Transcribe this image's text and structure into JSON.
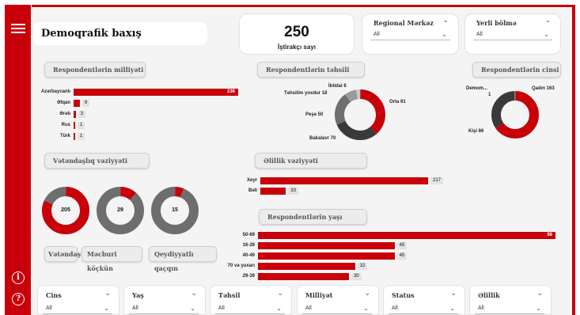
{
  "sidebar": {
    "menu_icon": "hamburger-menu-icon",
    "info_icon": "info-icon",
    "help_icon": "help-icon",
    "info_glyph": "i",
    "help_glyph": "?"
  },
  "header": {
    "title": "Demoqrafik baxış"
  },
  "participant_card": {
    "count": "250",
    "label": "İştirakçı sayı"
  },
  "top_slicers": [
    {
      "title": "Regional Mərkəz",
      "value": "All"
    },
    {
      "title": "Yerli bölmə",
      "value": "All"
    }
  ],
  "sections": {
    "nationality": "Respondentlərin milliyəti",
    "education": "Respondentlərin təhsili",
    "gender": "Respondentlərin cinsi",
    "citizenship": "Vətəndaşlıq vəziyyəti",
    "disability": "Əlillik vəziyyəti",
    "age": "Respondentlərin yaşı"
  },
  "nationality_chart": {
    "type": "bar",
    "categories": [
      "Azərbaycanlı",
      "Əfqan",
      "Ərəb",
      "Rus",
      "Türk"
    ],
    "values": [
      236,
      9,
      3,
      1,
      1
    ],
    "max": 236
  },
  "education_chart": {
    "type": "pie",
    "slices": [
      {
        "label": "Orta",
        "value": 91,
        "color": "#c8000a"
      },
      {
        "label": "Bakalavr",
        "value": 70,
        "color": "#3a3a3a"
      },
      {
        "label": "Peşə",
        "value": 50,
        "color": "#6e6e6e"
      },
      {
        "label": "Təhsilim yoxdur",
        "value": 18,
        "color": "#9a9a9a"
      },
      {
        "label": "İbtidai",
        "value": 6,
        "color": "#c8c8c8"
      }
    ]
  },
  "education_labels": [
    "Orta 91",
    "Bakalavr 70",
    "Peşə 50",
    "Təhsilim yoxdur 18",
    "İbtidai 6"
  ],
  "gender_chart": {
    "type": "pie",
    "slices": [
      {
        "label": "Qadın",
        "value": 163,
        "color": "#c8000a"
      },
      {
        "label": "Kişi",
        "value": 86,
        "color": "#3a3a3a"
      },
      {
        "label": "Demom...",
        "value": 1,
        "color": "#c8c8c8"
      }
    ]
  },
  "gender_labels": [
    "Qadın 163",
    "Kişi 86",
    "Demom...",
    "1"
  ],
  "citizenship_donuts": [
    {
      "center": "205",
      "value": 205,
      "total": 250,
      "label": "Vətəndaş"
    },
    {
      "center": "29",
      "value": 29,
      "total": 250,
      "label": "Məcburi köçkün"
    },
    {
      "center": "15",
      "value": 15,
      "total": 250,
      "label": "Qeydiyyatlı qaçqın"
    }
  ],
  "disability_chart": {
    "type": "bar",
    "categories": [
      "Xeyr",
      "Bəli"
    ],
    "values": [
      217,
      33
    ],
    "max": 217
  },
  "age_chart": {
    "type": "bar",
    "categories": [
      "50-69",
      "16-28",
      "40-49",
      "70 və yuxarı",
      "29-39"
    ],
    "values": [
      98,
      45,
      45,
      32,
      30
    ],
    "max": 98
  },
  "bottom_slicers": [
    {
      "title": "Cins",
      "value": "All"
    },
    {
      "title": "Yaş",
      "value": "All"
    },
    {
      "title": "Təhsil",
      "value": "All"
    },
    {
      "title": "Milliyət",
      "value": "All"
    },
    {
      "title": "Status",
      "value": "All"
    },
    {
      "title": "Əlillik",
      "value": "All"
    }
  ],
  "colors": {
    "accent": "#c8000a",
    "dark": "#3a3a3a",
    "grey": "#6e6e6e",
    "light_grey": "#c8c8c8"
  }
}
